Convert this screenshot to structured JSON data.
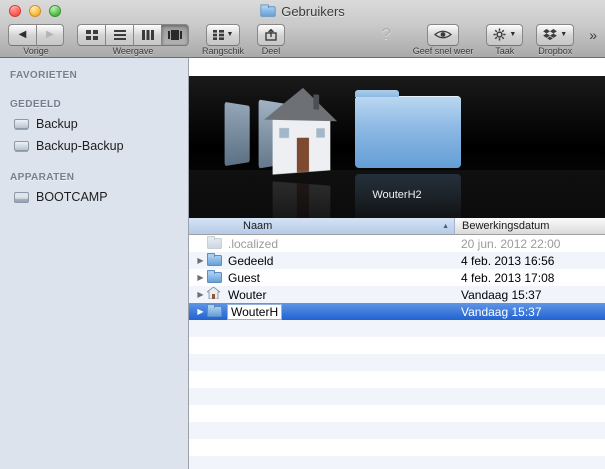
{
  "colors": {
    "selection": "#2f6fe0",
    "sidebar_background": "#dde3ec",
    "row_alternate": "#f1f5fb",
    "coverflow_background": "#000000",
    "header_sorted": "#bdd2ec"
  },
  "window": {
    "title": "Gebruikers"
  },
  "toolbar": {
    "back_label": "Vorige",
    "view_label": "Weergave",
    "arrange_label": "Rangschik",
    "share_label": "Deel",
    "help_symbol": "?",
    "quicklook_label": "Geef snel weer",
    "action_label": "Taak",
    "dropbox_label": "Dropbox",
    "overflow_symbol": "»"
  },
  "sidebar": {
    "sections": [
      {
        "title": "FAVORIETEN",
        "items": []
      },
      {
        "title": "GEDEELD",
        "items": [
          {
            "label": "Backup",
            "icon": "display"
          },
          {
            "label": "Backup-Backup",
            "icon": "display"
          }
        ]
      },
      {
        "title": "APPARATEN",
        "items": [
          {
            "label": "BOOTCAMP",
            "icon": "harddisk"
          }
        ]
      }
    ]
  },
  "coverflow": {
    "selected_label": "WouterH2"
  },
  "list": {
    "columns": [
      "Naam",
      "Bewerkingsdatum"
    ],
    "rows": [
      {
        "name": ".localized",
        "date": "20 jun. 2012 22:00",
        "icon": "folder",
        "disclosure": false,
        "dimmed": true,
        "selected": false,
        "editing": false
      },
      {
        "name": "Gedeeld",
        "date": "4 feb. 2013 16:56",
        "icon": "folder",
        "disclosure": true,
        "dimmed": false,
        "selected": false,
        "editing": false
      },
      {
        "name": "Guest",
        "date": "4 feb. 2013 17:08",
        "icon": "folder",
        "disclosure": true,
        "dimmed": false,
        "selected": false,
        "editing": false
      },
      {
        "name": "Wouter",
        "date": "Vandaag 15:37",
        "icon": "home",
        "disclosure": true,
        "dimmed": false,
        "selected": false,
        "editing": false
      },
      {
        "name": "WouterH",
        "date": "Vandaag 15:37",
        "icon": "folder",
        "disclosure": true,
        "dimmed": false,
        "selected": true,
        "editing": true
      }
    ]
  }
}
